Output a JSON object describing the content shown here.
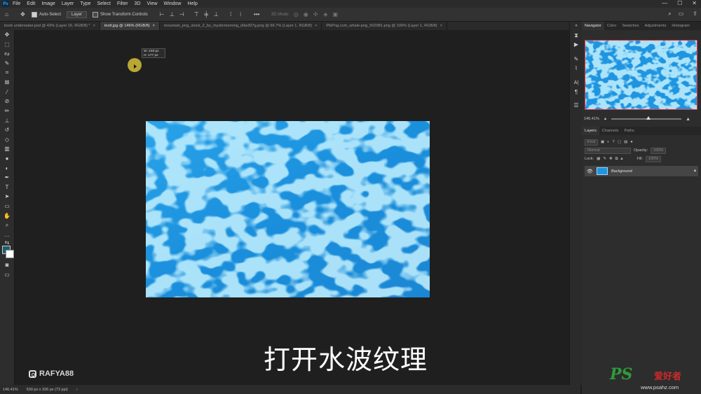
{
  "app": {
    "logo": "Ps"
  },
  "menubar": {
    "items": [
      "File",
      "Edit",
      "Image",
      "Layer",
      "Type",
      "Select",
      "Filter",
      "3D",
      "View",
      "Window",
      "Help"
    ],
    "win_controls": [
      "—",
      "☐",
      "✕"
    ]
  },
  "options": {
    "auto_select_label": "Auto-Select",
    "auto_select_value": "Layer",
    "show_transform_label": "Show Transform Controls",
    "mode_3d_label": "3D Mode:"
  },
  "tabs": [
    {
      "label": "book underwater.psd @ 43% (Layer 16, RGB/8) *",
      "active": false
    },
    {
      "label": "textt.jpg @ 146% (RGB/8)",
      "active": true
    },
    {
      "label": "mountain_png_stock_2_by_mysticmorning_d3w307g.png @ 66.7% (Layer 1, RGB/8)",
      "active": false
    },
    {
      "label": "PikPng.com_whale-png_502981.png @ 100% (Layer 1, RGB/8)",
      "active": false
    }
  ],
  "tooltip": {
    "w": "W:  248 px",
    "h": "H:  177 px"
  },
  "subtitle": "打开水波纹理",
  "watermark": {
    "handle": "RAFYA88",
    "site_logo": "PS",
    "site_sub": "爱好者",
    "site_url": "www.psahz.com"
  },
  "status": {
    "zoom": "146.41%",
    "doc_size": "530 px x 326 px (72 ppi)"
  },
  "navigator": {
    "tabs": [
      "Navigator",
      "Color",
      "Swatches",
      "Adjustments",
      "Histogram"
    ],
    "zoom": "146.41%"
  },
  "layers_panel": {
    "tabs": [
      "Layers",
      "Channels",
      "Paths"
    ],
    "filter_label": "Kind",
    "blend_mode": "Normal",
    "opacity_label": "Opacity:",
    "opacity_value": "100%",
    "lock_label": "Lock:",
    "fill_label": "Fill:",
    "fill_value": "100%",
    "layer_name": "Background"
  },
  "colors": {
    "water": "#1f95e0",
    "accent": "#31a8ff"
  }
}
